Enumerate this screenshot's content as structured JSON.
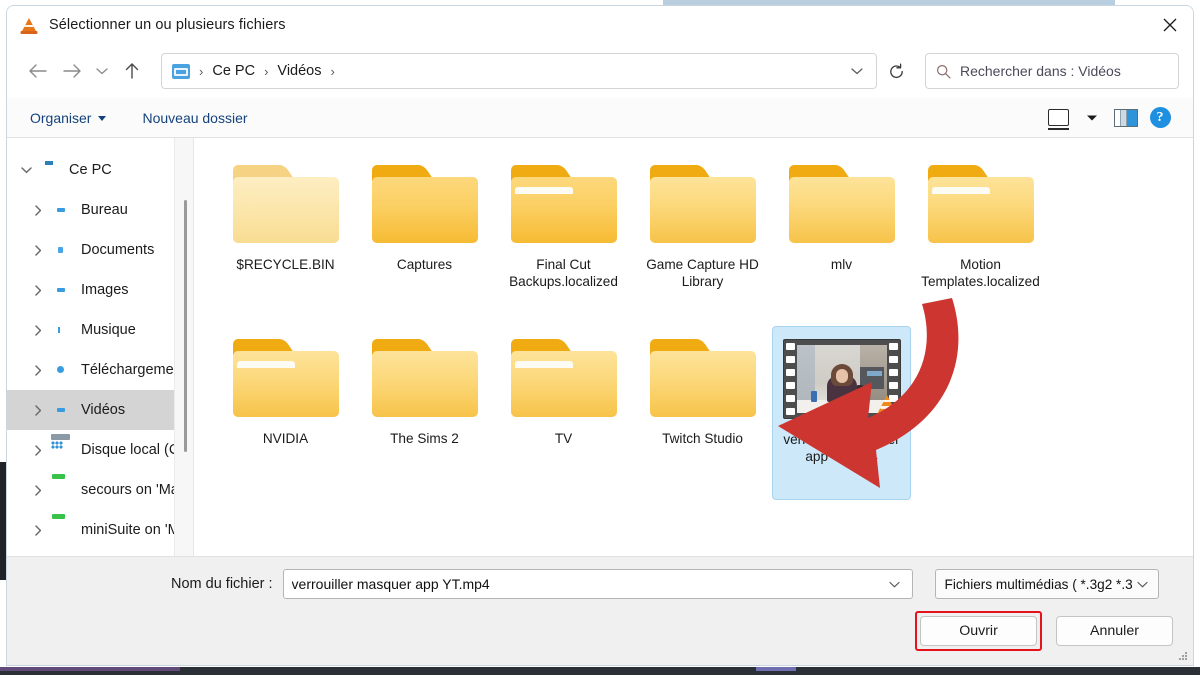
{
  "window": {
    "title": "Sélectionner un ou plusieurs fichiers",
    "app_icon": "vlc-cone-icon",
    "close_label": "✕"
  },
  "nav": {
    "back_icon": "arrow-left-icon",
    "forward_icon": "arrow-right-icon",
    "recent_icon": "chevron-down-icon",
    "up_icon": "arrow-up-icon",
    "refresh_icon": "refresh-icon",
    "breadcrumb": [
      "Ce PC",
      "Vidéos"
    ],
    "breadcrumb_separator": "›"
  },
  "search": {
    "placeholder": "Rechercher dans : Vidéos",
    "icon": "search-icon"
  },
  "toolbar": {
    "organize_label": "Organiser",
    "new_folder_label": "Nouveau dossier",
    "view_icon": "monitor-view-icon",
    "panes_icon": "preview-pane-icon",
    "help_label": "?"
  },
  "sidebar": {
    "items": [
      {
        "label": "Ce PC",
        "icon": "computer-icon",
        "expanded": true,
        "indent": 0,
        "selected": false
      },
      {
        "label": "Bureau",
        "icon": "folder-desktop-icon",
        "expanded": false,
        "indent": 1,
        "selected": false
      },
      {
        "label": "Documents",
        "icon": "folder-documents-icon",
        "expanded": false,
        "indent": 1,
        "selected": false
      },
      {
        "label": "Images",
        "icon": "folder-pictures-icon",
        "expanded": false,
        "indent": 1,
        "selected": false
      },
      {
        "label": "Musique",
        "icon": "folder-music-icon",
        "expanded": false,
        "indent": 1,
        "selected": false
      },
      {
        "label": "Téléchargemen",
        "icon": "folder-downloads-icon",
        "expanded": false,
        "indent": 1,
        "selected": false
      },
      {
        "label": "Vidéos",
        "icon": "folder-videos-icon",
        "expanded": false,
        "indent": 1,
        "selected": true
      },
      {
        "label": "Disque local (C:",
        "icon": "local-disk-icon",
        "expanded": false,
        "indent": 1,
        "selected": false
      },
      {
        "label": "secours on 'Ma",
        "icon": "network-drive-icon",
        "expanded": false,
        "indent": 1,
        "selected": false
      },
      {
        "label": "miniSuite on 'M",
        "icon": "network-drive-icon",
        "expanded": false,
        "indent": 1,
        "selected": false
      }
    ]
  },
  "files": [
    {
      "name": "$RECYCLE.BIN",
      "type": "folder",
      "style": "faded",
      "selected": false
    },
    {
      "name": "Captures",
      "type": "folder",
      "style": "bright",
      "selected": false
    },
    {
      "name": "Final Cut Backups.localized",
      "type": "folder",
      "style": "sheet",
      "selected": false
    },
    {
      "name": "Game Capture HD Library",
      "type": "folder",
      "style": "normal",
      "selected": false
    },
    {
      "name": "mlv",
      "type": "folder",
      "style": "normal",
      "selected": false
    },
    {
      "name": "Motion Templates.localized",
      "type": "folder",
      "style": "sheet",
      "selected": false
    },
    {
      "name": "NVIDIA",
      "type": "folder",
      "style": "sheet",
      "selected": false
    },
    {
      "name": "The Sims 2",
      "type": "folder",
      "style": "normal",
      "selected": false
    },
    {
      "name": "TV",
      "type": "folder",
      "style": "sheet",
      "selected": false
    },
    {
      "name": "Twitch Studio",
      "type": "folder",
      "style": "normal",
      "selected": false
    },
    {
      "name": "verrouiller masquer app YT.mp4",
      "type": "video",
      "style": "thumbnail",
      "selected": true
    }
  ],
  "footer": {
    "filename_label": "Nom du fichier :",
    "filename_value": "verrouiller masquer app YT.mp4",
    "filter_value": "Fichiers multimédias ( *.3g2 *.3",
    "open_label": "Ouvrir",
    "cancel_label": "Annuler"
  },
  "annotation": {
    "arrow_color": "#cd3531",
    "highlight_color": "#e4121b",
    "arrow_target": "verrouiller masquer app YT.mp4"
  }
}
